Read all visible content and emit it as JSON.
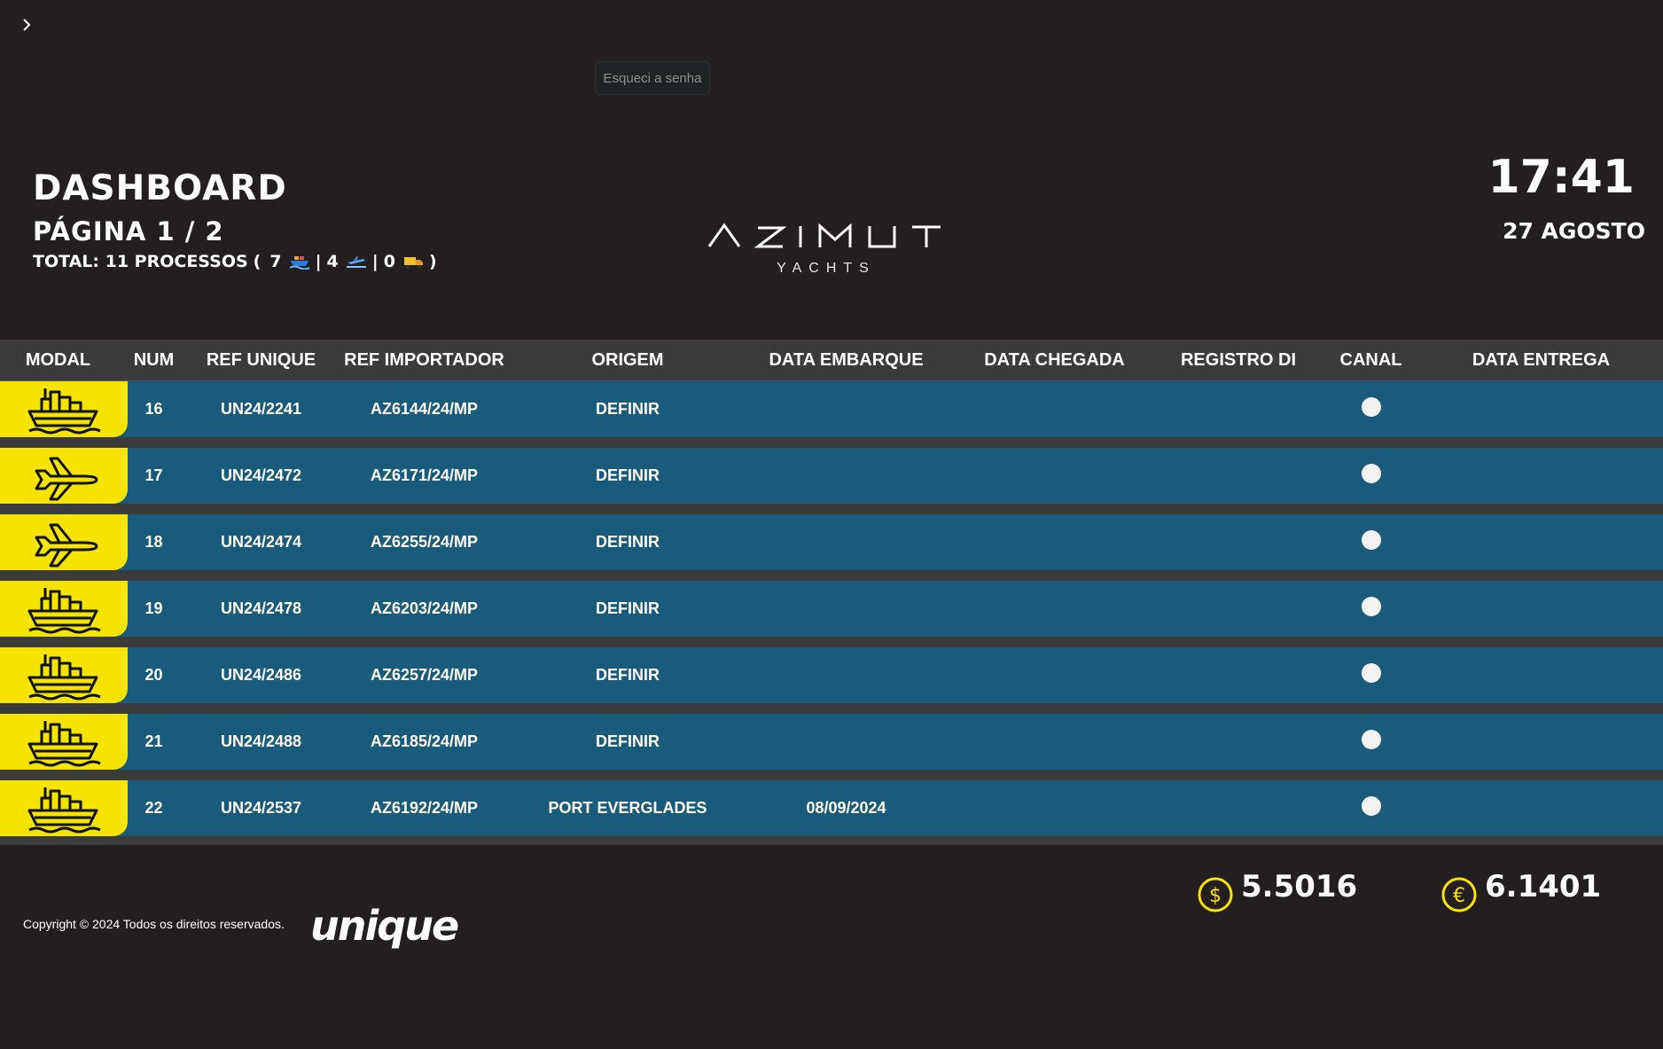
{
  "header": {
    "title": "DASHBOARD",
    "page_info": "PÁGINA 1 / 2",
    "summary": {
      "prefix": "TOTAL: 11 PROCESSOS",
      "open": "(",
      "sea_count": "7",
      "air_count": "4",
      "road_count": "0",
      "sep": "|",
      "close": ")"
    },
    "forgot_password": "Esqueci a senha",
    "time": "17:41",
    "date": "27 AGOSTO"
  },
  "logo": {
    "name": "AZIMUT",
    "sub": "YACHTS"
  },
  "table": {
    "columns": [
      "MODAL",
      "NUM",
      "REF UNIQUE",
      "REF IMPORTADOR",
      "ORIGEM",
      "DATA EMBARQUE",
      "DATA CHEGADA",
      "REGISTRO DI",
      "CANAL",
      "DATA ENTREGA"
    ],
    "rows": [
      {
        "modal": "ship-icon",
        "num": "16",
        "ref_unique": "UN24/2241",
        "ref_importador": "AZ6144/24/MP",
        "origem": "DEFINIR",
        "data_embarque": "",
        "data_chegada": "",
        "registro_di": "",
        "canal": "white",
        "data_entrega": ""
      },
      {
        "modal": "plane-icon",
        "num": "17",
        "ref_unique": "UN24/2472",
        "ref_importador": "AZ6171/24/MP",
        "origem": "DEFINIR",
        "data_embarque": "",
        "data_chegada": "",
        "registro_di": "",
        "canal": "white",
        "data_entrega": ""
      },
      {
        "modal": "plane-icon",
        "num": "18",
        "ref_unique": "UN24/2474",
        "ref_importador": "AZ6255/24/MP",
        "origem": "DEFINIR",
        "data_embarque": "",
        "data_chegada": "",
        "registro_di": "",
        "canal": "white",
        "data_entrega": ""
      },
      {
        "modal": "ship-icon",
        "num": "19",
        "ref_unique": "UN24/2478",
        "ref_importador": "AZ6203/24/MP",
        "origem": "DEFINIR",
        "data_embarque": "",
        "data_chegada": "",
        "registro_di": "",
        "canal": "white",
        "data_entrega": ""
      },
      {
        "modal": "ship-icon",
        "num": "20",
        "ref_unique": "UN24/2486",
        "ref_importador": "AZ6257/24/MP",
        "origem": "DEFINIR",
        "data_embarque": "",
        "data_chegada": "",
        "registro_di": "",
        "canal": "white",
        "data_entrega": ""
      },
      {
        "modal": "ship-icon",
        "num": "21",
        "ref_unique": "UN24/2488",
        "ref_importador": "AZ6185/24/MP",
        "origem": "DEFINIR",
        "data_embarque": "",
        "data_chegada": "",
        "registro_di": "",
        "canal": "white",
        "data_entrega": ""
      },
      {
        "modal": "ship-icon",
        "num": "22",
        "ref_unique": "UN24/2537",
        "ref_importador": "AZ6192/24/MP",
        "origem": "PORT EVERGLADES",
        "data_embarque": "08/09/2024",
        "data_chegada": "",
        "registro_di": "",
        "canal": "white",
        "data_entrega": ""
      }
    ]
  },
  "footer": {
    "copyright": "Copyright © 2024 Todos os direitos reservados.",
    "brand": "unique",
    "usd_rate": "5.5016",
    "eur_rate": "6.1401",
    "usd_symbol": "$",
    "eur_symbol": "€"
  },
  "colors": {
    "background": "#231f20",
    "row": "#1a5a7a",
    "header_row": "#3b3b3b",
    "modal_badge": "#f5e300",
    "canal_white": "#f2f2f2"
  }
}
